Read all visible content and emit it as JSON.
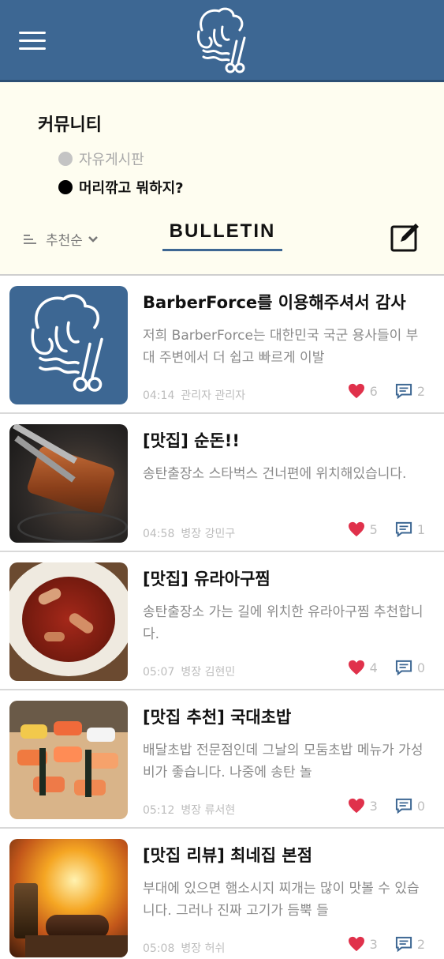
{
  "colors": {
    "primary": "#3d6793",
    "background": "#fefdf0",
    "heart": "#e0314b"
  },
  "header": {
    "menu_icon": "hamburger-menu-icon",
    "logo_icon": "barberforce-logo"
  },
  "community": {
    "title": "커뮤니티",
    "boards": [
      {
        "label": "자유게시판",
        "active": false
      },
      {
        "label": "머리깎고 뭐하지?",
        "active": true
      }
    ]
  },
  "toolbar": {
    "sort_label": "추천순",
    "tab_label": "BULLETIN",
    "write_icon": "edit-icon"
  },
  "posts": [
    {
      "title": "BarberForce를 이용해주셔서 감사",
      "body": "저희 BarberForce는 대한민국 국군 용사들이 부대 주변에서 더 쉽고 빠르게 이발",
      "time": "04:14",
      "author": "관리자 관리자",
      "likes": "6",
      "comments": "2",
      "thumb": "logo"
    },
    {
      "title": "[맛집] 순돈!!",
      "body": "송탄출장소 스타벅스 건너편에 위치해있습니다.",
      "time": "04:58",
      "author": "병장 강민구",
      "likes": "5",
      "comments": "1",
      "thumb": "pork-photo"
    },
    {
      "title": "[맛집] 유라아구찜",
      "body": "송탄출장소 가는 길에 위치한 유라아구찜 추천합니다.",
      "time": "05:07",
      "author": "병장 김현민",
      "likes": "4",
      "comments": "0",
      "thumb": "agujjim-photo"
    },
    {
      "title": "[맛집 추천] 국대초밥",
      "body": "배달초밥 전문점인데 그날의 모둠초밥 메뉴가 가성비가 좋습니다. 나중에 송탄 놀",
      "time": "05:12",
      "author": "병장 류서현",
      "likes": "3",
      "comments": "0",
      "thumb": "sushi-photo"
    },
    {
      "title": "[맛집 리뷰] 최네집 본점",
      "body": "부대에 있으면 햄소시지 찌개는 많이 맛볼 수 있습니다. 그러나 진짜 고기가 듬뿍 들",
      "time": "05:08",
      "author": "병장 허쉬",
      "likes": "3",
      "comments": "2",
      "thumb": "steak-photo"
    }
  ]
}
